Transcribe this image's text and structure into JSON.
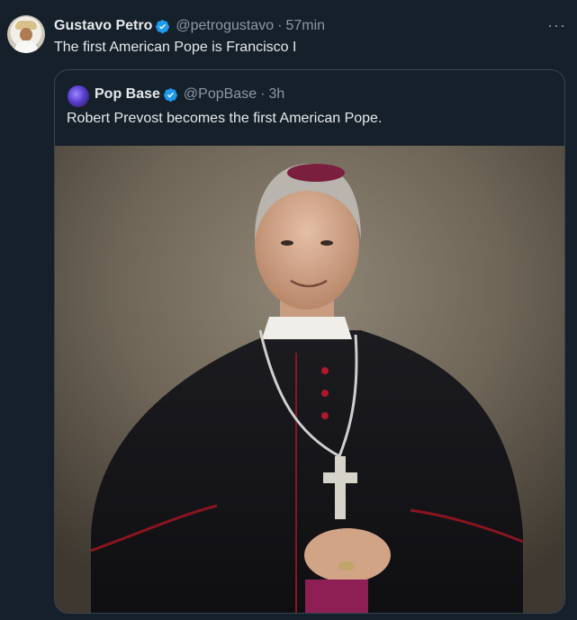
{
  "tweet": {
    "author_name": "Gustavo Petro",
    "author_handle": "@petrogustavo",
    "separator": "·",
    "timestamp": "57min",
    "text": "The first American Pope is Francisco I",
    "more_label": "···"
  },
  "quoted_tweet": {
    "author_name": "Pop Base",
    "author_handle": "@PopBase",
    "separator": "·",
    "timestamp": "3h",
    "text": "Robert Prevost becomes the first American Pope."
  },
  "colors": {
    "background": "#15202b",
    "border": "#38444d",
    "verified_blue": "#1d9bf0",
    "secondary_text": "#8b98a5"
  },
  "icons": {
    "verified": "verified-badge-icon",
    "more": "more-options-icon"
  }
}
